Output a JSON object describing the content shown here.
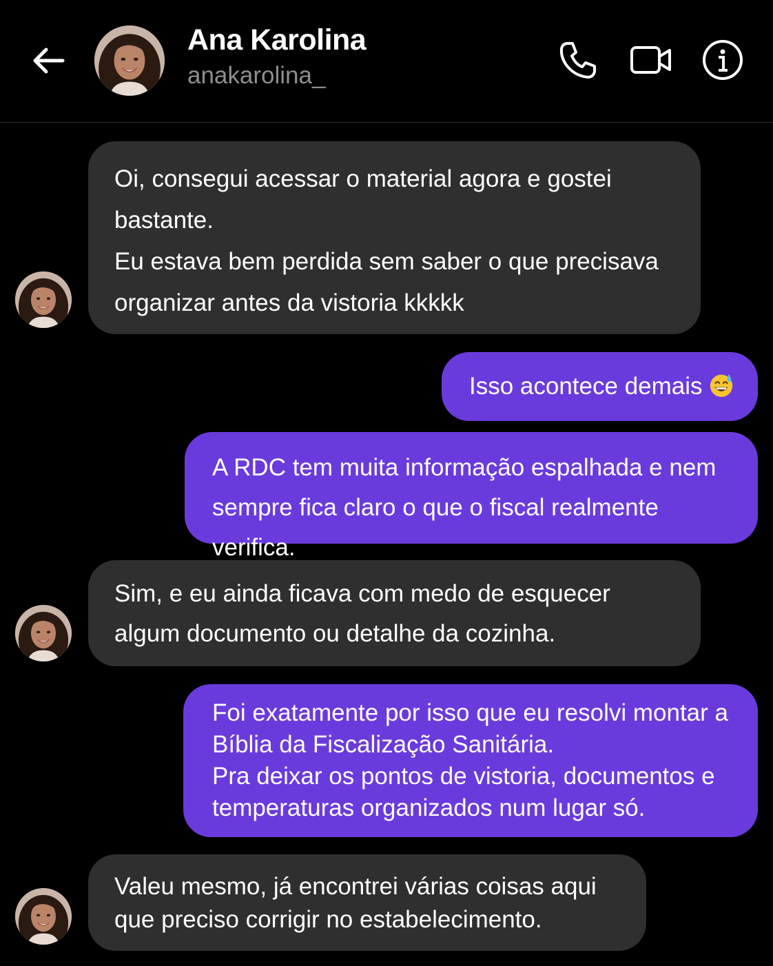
{
  "header": {
    "back_icon": "arrow-left-icon",
    "contact_name": "Ana Karolina",
    "contact_handle": "anakarolina_",
    "actions": [
      "phone-icon",
      "video-camera-icon",
      "info-icon"
    ]
  },
  "colors": {
    "background": "#000000",
    "incoming_bubble": "#2f2f2f",
    "outgoing_bubble": "#6a3bdc",
    "handle_text": "#8e8e8e"
  },
  "messages": [
    {
      "sender": "contact",
      "text": "Oi, consegui acessar o material agora e gostei bastante.\nEu estava bem perdida sem saber o que precisava organizar antes da vistoria kkkkk"
    },
    {
      "sender": "me",
      "text": "Isso acontece demais",
      "emoji": "grinning-face-with-sweat"
    },
    {
      "sender": "me",
      "text": "A RDC tem muita informação espalhada e nem sempre fica claro o que o fiscal realmente verifica."
    },
    {
      "sender": "contact",
      "text": "Sim, e eu ainda ficava com medo de esquecer algum documento ou detalhe da cozinha."
    },
    {
      "sender": "me",
      "text": "Foi exatamente por isso que eu resolvi montar a Bíblia da Fiscalização Sanitária.\nPra deixar os pontos de vistoria, documentos e temperaturas organizados num lugar só."
    },
    {
      "sender": "contact",
      "text": "Valeu mesmo, já encontrei várias coisas aqui que preciso corrigir no estabelecimento."
    }
  ]
}
